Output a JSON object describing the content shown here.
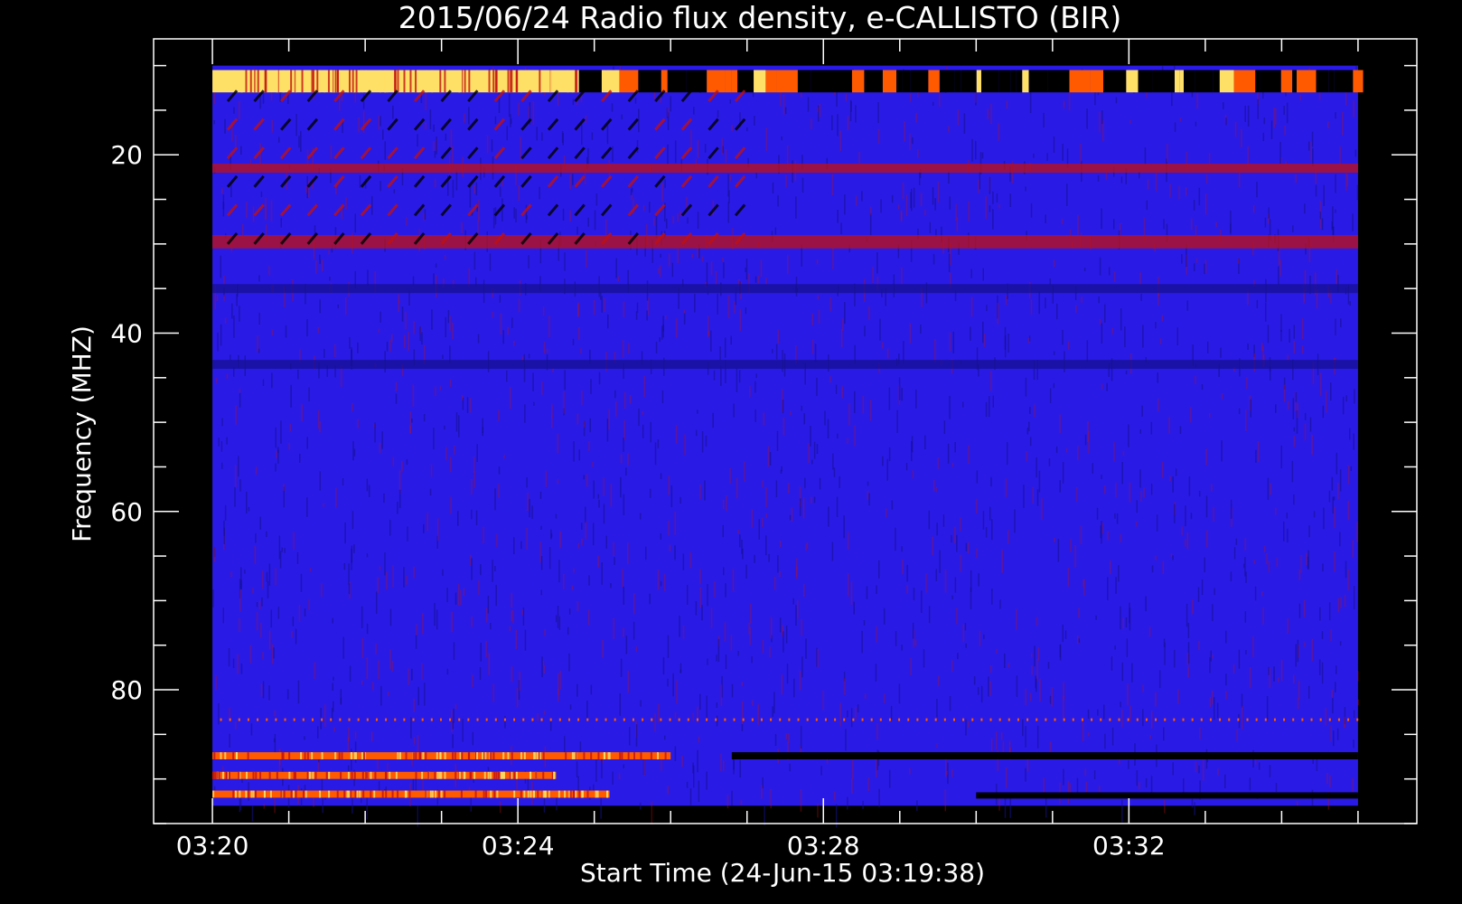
{
  "chart_data": {
    "type": "heatmap",
    "title": "2015/06/24  Radio flux density, e-CALLISTO (BIR)",
    "xlabel": "Start Time (24-Jun-15 03:19:38)",
    "ylabel": "Frequency (MHZ)",
    "x_tick_labels": [
      "03:20",
      "03:24",
      "03:28",
      "03:32"
    ],
    "y_tick_labels": [
      "20",
      "40",
      "60",
      "80"
    ],
    "x_ticks_minutes": [
      20,
      24,
      28,
      32
    ],
    "y_ticks": [
      20,
      40,
      60,
      80
    ],
    "xlim_minutes": [
      19.23,
      35.77
    ],
    "data_xlim_minutes": [
      20.0,
      35.0
    ],
    "ylim": [
      95.0,
      7.0
    ],
    "data_ylim": [
      10.0,
      93.0
    ],
    "y_reversed": true,
    "grid": false,
    "colormap": "red-temperature (blue background, red/yellow high flux)",
    "colors": {
      "background": "#000000",
      "axes": "#ffffff",
      "field": "#2a1ae6",
      "field_dark": "#14108c",
      "hot": "#ff5a00",
      "peak": "#ffe066",
      "red": "#c01010"
    },
    "bands": [
      {
        "f_low": 10.5,
        "f_high": 13.0,
        "t_start": 20.0,
        "t_end": 24.8,
        "level": "peak"
      },
      {
        "f_low": 10.5,
        "f_high": 13.0,
        "t_start": 24.8,
        "t_end": 35.0,
        "level": "intermittent"
      },
      {
        "f_low": 21.0,
        "f_high": 22.0,
        "t_start": 20.0,
        "t_end": 35.0,
        "level": "medium"
      },
      {
        "f_low": 29.0,
        "f_high": 30.5,
        "t_start": 20.0,
        "t_end": 35.0,
        "level": "medium"
      },
      {
        "f_low": 34.5,
        "f_high": 35.5,
        "t_start": 20.0,
        "t_end": 35.0,
        "level": "low"
      },
      {
        "f_low": 43.0,
        "f_high": 44.0,
        "t_start": 20.0,
        "t_end": 35.0,
        "level": "low"
      },
      {
        "f_low": 87.0,
        "f_high": 87.8,
        "t_start": 20.0,
        "t_end": 26.0,
        "level": "high"
      },
      {
        "f_low": 89.2,
        "f_high": 90.0,
        "t_start": 20.0,
        "t_end": 24.5,
        "level": "high"
      },
      {
        "f_low": 91.3,
        "f_high": 92.1,
        "t_start": 20.0,
        "t_end": 25.2,
        "level": "high"
      },
      {
        "f_low": 87.0,
        "f_high": 87.8,
        "t_start": 26.8,
        "t_end": 35.0,
        "level": "dark"
      },
      {
        "f_low": 91.5,
        "f_high": 92.2,
        "t_start": 30.0,
        "t_end": 35.0,
        "level": "dark"
      }
    ]
  }
}
